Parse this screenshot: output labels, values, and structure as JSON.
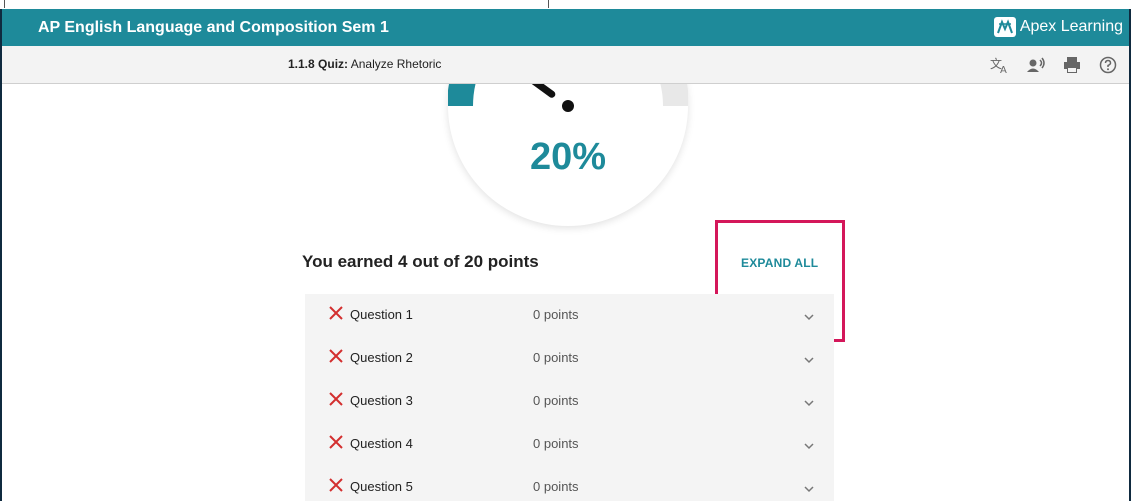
{
  "app_title": "AP English Language and Composition Sem 1",
  "brand": {
    "name": "Apex Learning",
    "accent": "#1e8a9a",
    "highlight": "#d4175a"
  },
  "toolbar": {
    "lesson_number": "1.1.8",
    "kind": "Quiz:",
    "title": "Analyze Rhetoric",
    "icons": [
      "translate-icon",
      "read-aloud-icon",
      "print-icon",
      "help-icon"
    ]
  },
  "score": {
    "percent_text": "20%",
    "percent": 20,
    "earned_text": "You earned 4 out of 20 points"
  },
  "expand_all_label": "EXPAND ALL",
  "questions": [
    {
      "label": "Question 1",
      "points": "0 points",
      "status": "incorrect"
    },
    {
      "label": "Question 2",
      "points": "0 points",
      "status": "incorrect"
    },
    {
      "label": "Question 3",
      "points": "0 points",
      "status": "incorrect"
    },
    {
      "label": "Question 4",
      "points": "0 points",
      "status": "incorrect"
    },
    {
      "label": "Question 5",
      "points": "0 points",
      "status": "incorrect"
    }
  ]
}
